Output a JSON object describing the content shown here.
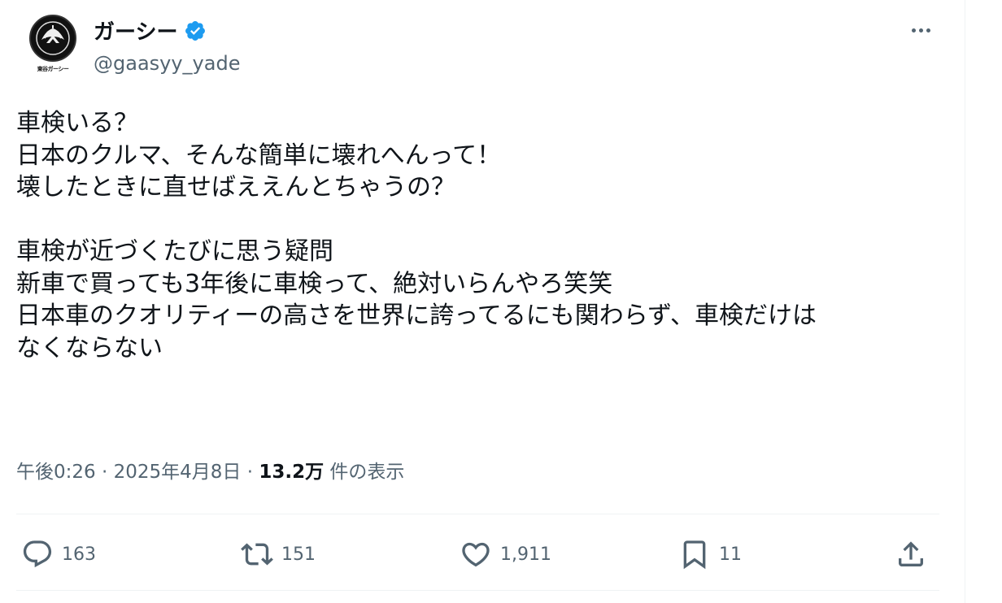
{
  "author": {
    "display_name": "ガーシー",
    "handle": "@gaasyy_yade",
    "avatar_caption": "東谷ガーシー"
  },
  "tweet": {
    "lines": [
      "車検いる？",
      "日本のクルマ、そんな簡単に壊れへんって！",
      "壊したときに直せばええんとちゃうの？",
      "",
      "車検が近づくたびに思う疑問",
      "新車で買っても3年後に車検って、絶対いらんやろ笑笑",
      "日本車のクオリティーの高さを世界に誇ってるにも関わらず、車検だけは",
      "なくならない"
    ]
  },
  "meta": {
    "time": "午後0:26",
    "separator": " · ",
    "date": "2025年4月8日",
    "views_count": "13.2万",
    "views_label": " 件の表示"
  },
  "actions": {
    "replies": "163",
    "reposts": "151",
    "likes": "1,911",
    "bookmarks": "11"
  },
  "icons": {
    "verified": "verified-badge-icon",
    "more": "more-icon",
    "reply": "reply-icon",
    "repost": "repost-icon",
    "like": "like-icon",
    "bookmark": "bookmark-icon",
    "share": "share-icon"
  },
  "colors": {
    "verified": "#1d9bf0",
    "text": "#0f1419",
    "secondary": "#536471"
  }
}
